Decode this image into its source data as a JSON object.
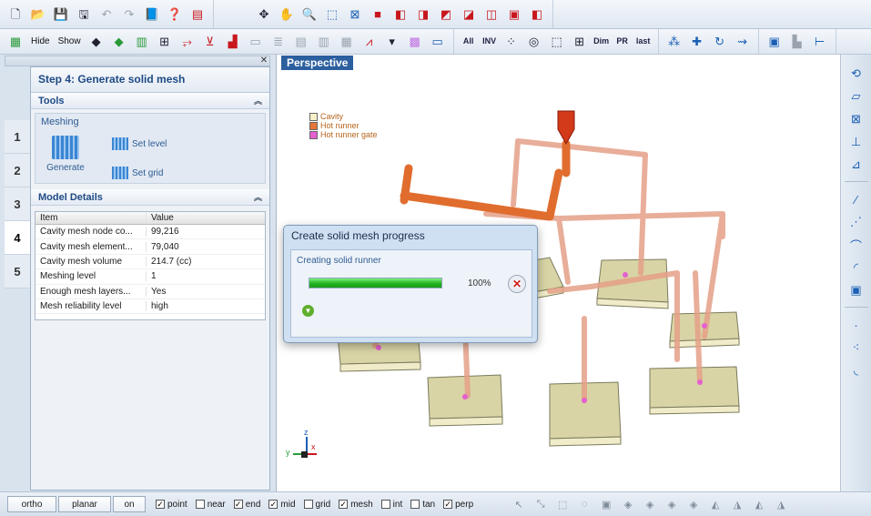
{
  "toolbar1": {
    "icons": [
      "new-file-icon",
      "open-folder-icon",
      "save-icon",
      "save-all-icon",
      "undo-icon",
      "redo-icon",
      "book-icon",
      "help-icon",
      "report-icon"
    ],
    "view_icons": [
      "pan-icon",
      "hand-icon",
      "zoom-icon",
      "zoom-window-icon",
      "fit-icon",
      "red-square-icon",
      "cube-view-1-icon",
      "cube-view-2-icon",
      "cube-view-3-icon",
      "cube-view-4-icon",
      "cube-view-5-icon",
      "cube-view-6-icon",
      "cube-view-7-icon"
    ]
  },
  "toolbar2": {
    "hide_label": "Hide",
    "show_label": "Show",
    "select_labels": [
      "All",
      "INV",
      "last"
    ],
    "dim_label": "Dim",
    "pr_label": "PR"
  },
  "panel": {
    "step_title": "Step 4: Generate solid mesh",
    "step_numbers": [
      "1",
      "2",
      "3",
      "4",
      "5"
    ],
    "active_step": "4",
    "tools_header": "Tools",
    "meshing_label": "Meshing",
    "generate_label": "Generate",
    "set_level_label": "Set level",
    "set_grid_label": "Set grid",
    "model_details_header": "Model Details",
    "columns": [
      "Item",
      "Value"
    ],
    "rows": [
      [
        "Cavity mesh node co...",
        "99,216"
      ],
      [
        "Cavity mesh element...",
        "79,040"
      ],
      [
        "Cavity mesh volume",
        "214.7 (cc)"
      ],
      [
        "Meshing level",
        "1"
      ],
      [
        "Enough mesh layers...",
        "Yes"
      ],
      [
        "Mesh reliability level",
        "high"
      ]
    ]
  },
  "viewport": {
    "title": "Perspective",
    "legend": [
      {
        "label": "Cavity",
        "color": "#f7f0c8"
      },
      {
        "label": "Hot runner",
        "color": "#e6773a"
      },
      {
        "label": "Hot runner gate",
        "color": "#e55fd0"
      }
    ],
    "axes": {
      "x": "x",
      "y": "y",
      "z": "z"
    }
  },
  "dialog": {
    "title": "Create solid mesh progress",
    "message": "Creating solid runner",
    "progress": 100,
    "progress_text": "100%"
  },
  "statusbar": {
    "ortho": "ortho",
    "planar": "planar",
    "on": "on",
    "options": [
      {
        "label": "point",
        "checked": true
      },
      {
        "label": "near",
        "checked": false
      },
      {
        "label": "end",
        "checked": true
      },
      {
        "label": "mid",
        "checked": true
      },
      {
        "label": "grid",
        "checked": false
      },
      {
        "label": "mesh",
        "checked": true
      },
      {
        "label": "int",
        "checked": false
      },
      {
        "label": "tan",
        "checked": false
      },
      {
        "label": "perp",
        "checked": true
      }
    ]
  }
}
